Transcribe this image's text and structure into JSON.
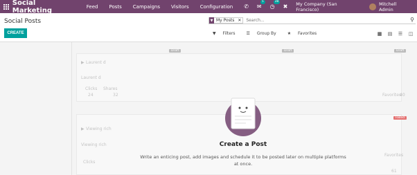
{
  "topbar": {
    "brand": "Social Marketing",
    "menu": [
      "Feed",
      "Posts",
      "Campaigns",
      "Visitors",
      "Configuration"
    ],
    "messages_count": "5",
    "activities_count": "38",
    "company": "My Company (San Francisco)",
    "user": "Mitchell Admin",
    "colors": {
      "primary": "#71436d",
      "accent": "#00a09d"
    }
  },
  "control_panel": {
    "title": "Social Posts",
    "create_label": "CREATE",
    "facet_label": "My Posts",
    "search_placeholder": "Search...",
    "filters_label": "Filters",
    "groupby_label": "Group By",
    "favorites_label": "Favorites",
    "views": [
      "kanban-view",
      "calendar-view",
      "list-view",
      "pivot-view"
    ]
  },
  "background": {
    "tags": [
      "Draft",
      "Draft",
      "Draft",
      "Failed"
    ],
    "card1_name": "Laurent d",
    "card1_sub": "Laurent d",
    "card1_stats_labels": [
      "Clicks",
      "Shares"
    ],
    "card1_stats_values": [
      "24",
      "32"
    ],
    "card2_name": "Viewing rich",
    "card2_sub": "Viewing rich",
    "card2_stats_label": "Clicks",
    "card3_right_label": "Favorites",
    "card3_right_value": "40",
    "card4_right_label": "Favorites",
    "card4_right_value": "61"
  },
  "helper": {
    "title": "Create a Post",
    "text": "Write an enticing post, add images and schedule it to be posted later on multiple platforms at once."
  }
}
